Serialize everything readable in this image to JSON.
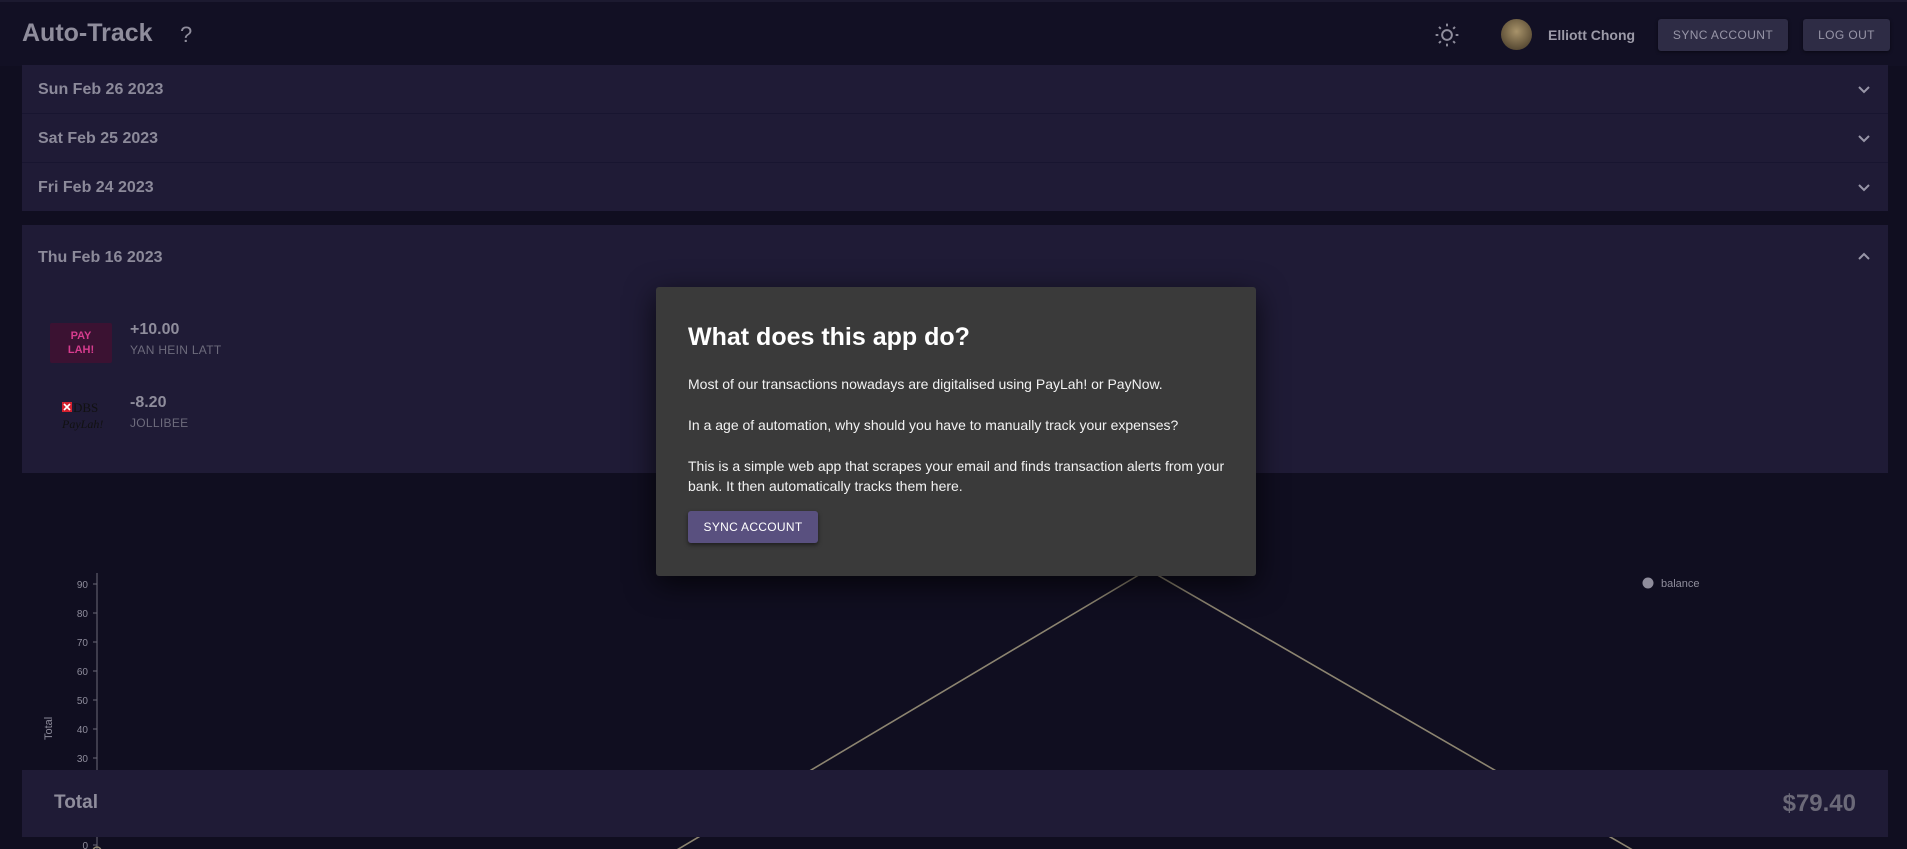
{
  "header": {
    "app_title": "Auto-Track",
    "help_icon": "?",
    "theme_icon": "sun-icon",
    "user_name": "Elliott Chong",
    "sync_label": "SYNC ACCOUNT",
    "logout_label": "LOG OUT"
  },
  "days": [
    {
      "date": "Sun Feb 26 2023"
    },
    {
      "date": "Sat Feb 25 2023"
    },
    {
      "date": "Fri Feb 24 2023"
    }
  ],
  "expanded_day": {
    "date": "Thu Feb 16 2023",
    "transactions": [
      {
        "amount": "+10.00",
        "party": "YAN HEIN LATT",
        "logo": "paylah-logo"
      },
      {
        "amount": "-8.20",
        "party": "JOLLIBEE",
        "logo": "dbs-paylah-logo"
      }
    ]
  },
  "modal": {
    "title": "What does this app do?",
    "paragraphs": [
      "Most of our transactions nowadays are digitalised using PayLah! or PayNow.",
      "In a age of automation, why should you have to manually track your expenses?",
      "This is a simple web app that scrapes your email and finds transaction alerts from your bank. It then automatically tracks them here."
    ],
    "button_label": "SYNC ACCOUNT"
  },
  "chart_data": {
    "type": "line",
    "ylabel": "Total",
    "y_ticks": [
      "90",
      "80",
      "70",
      "60",
      "50",
      "40",
      "30",
      "0"
    ],
    "series": [
      {
        "name": "balance",
        "values": [
          0,
          95,
          0
        ]
      }
    ],
    "legend": "top-right",
    "colors": {
      "line": "#8c8470",
      "legend_dot": "#8f8d9c"
    }
  },
  "total": {
    "label": "Total",
    "value": "$79.40"
  }
}
